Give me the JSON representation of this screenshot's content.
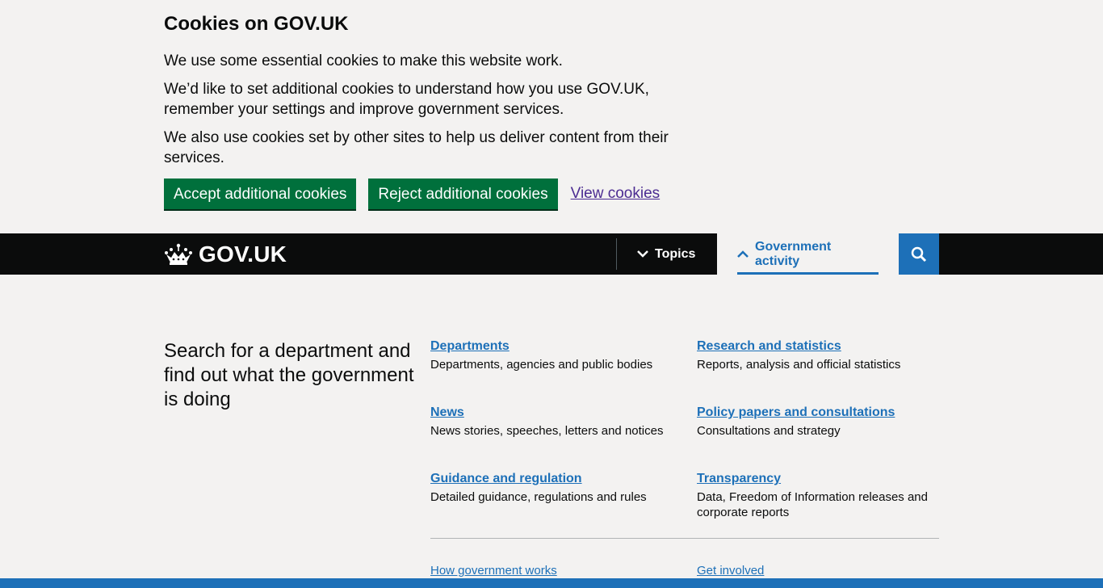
{
  "cookie_banner": {
    "title": "Cookies on GOV.UK",
    "paragraphs": [
      "We use some essential cookies to make this website work.",
      "We’d like to set additional cookies to understand how you use GOV.UK, remember your settings and improve government services.",
      "We also use cookies set by other sites to help us deliver content from their services."
    ],
    "accept_label": "Accept additional cookies",
    "reject_label": "Reject additional cookies",
    "view_label": "View cookies"
  },
  "header": {
    "logo_text": "GOV.UK",
    "topics_label": "Topics",
    "gov_activity_label": "Government activity",
    "search_icon": "search-icon"
  },
  "menu": {
    "intro": "Search for a department and find out what the government is doing",
    "items": [
      {
        "title": "Departments",
        "desc": "Departments, agencies and public bodies"
      },
      {
        "title": "Research and statistics",
        "desc": "Reports, analysis and official statistics"
      },
      {
        "title": "News",
        "desc": "News stories, speeches, letters and notices"
      },
      {
        "title": "Policy papers and consultations",
        "desc": "Consultations and strategy"
      },
      {
        "title": "Guidance and regulation",
        "desc": "Detailed guidance, regulations and rules"
      },
      {
        "title": "Transparency",
        "desc": "Data, Freedom of Information releases and corporate reports"
      }
    ],
    "secondary_links": [
      "How government works",
      "Get involved"
    ]
  },
  "colors": {
    "green_button": "#00703c",
    "link_blue": "#1d70b8",
    "visited_purple": "#4c2c92",
    "header_black": "#0b0c0c",
    "background": "#f3f2f1"
  }
}
